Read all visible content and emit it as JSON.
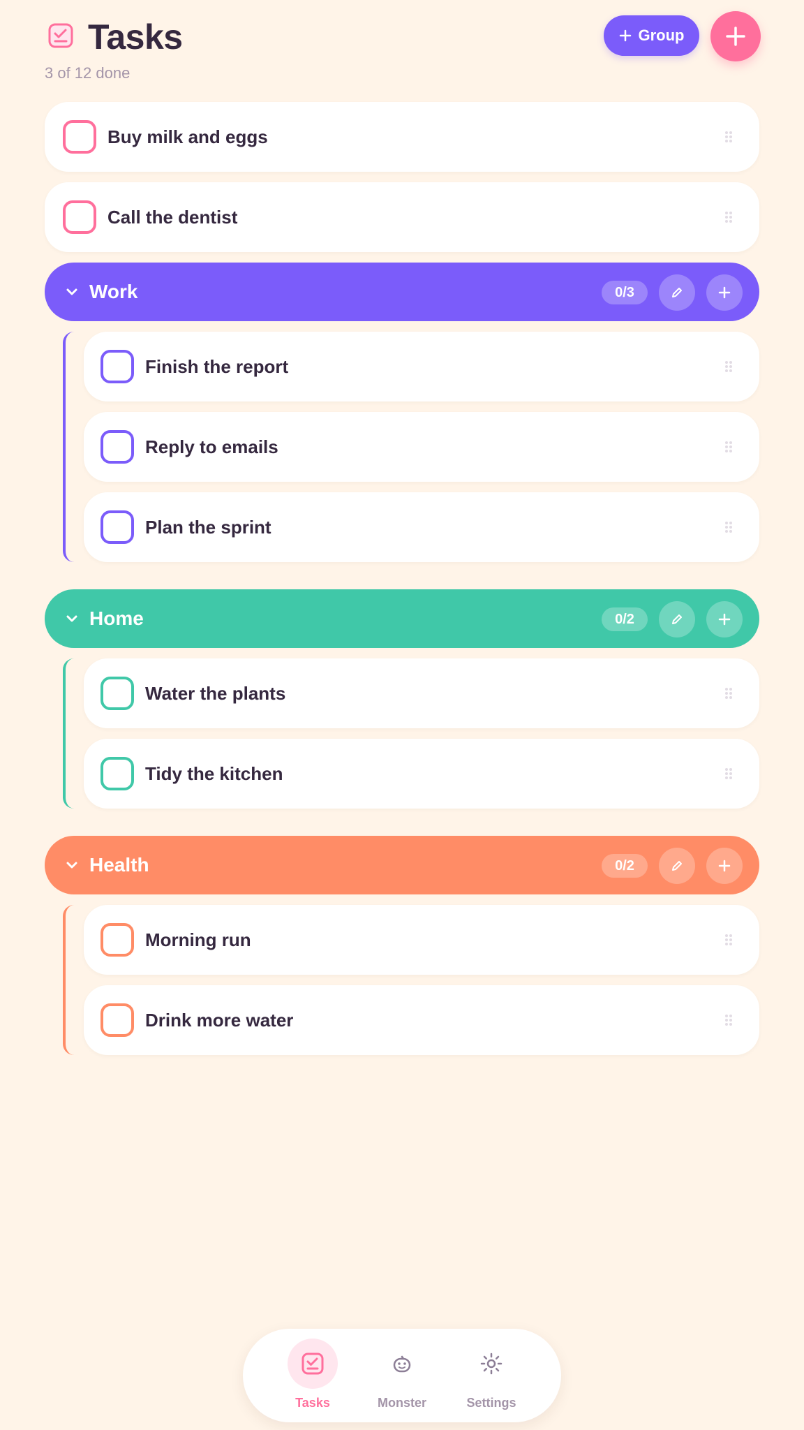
{
  "header": {
    "title": "Tasks",
    "subtitle": "3 of 12 done",
    "group_button_label": "Group",
    "app_icon": "checkbox-icon",
    "accent": "#FF6F9C"
  },
  "loose_tasks": [
    {
      "label": "Buy milk and eggs"
    },
    {
      "label": "Call the dentist"
    }
  ],
  "groups": [
    {
      "name": "Work",
      "count": "0/3",
      "color": "#7B5CFA",
      "tasks": [
        {
          "label": "Finish the report"
        },
        {
          "label": "Reply to emails"
        },
        {
          "label": "Plan the sprint"
        }
      ]
    },
    {
      "name": "Home",
      "count": "0/2",
      "color": "#40C8A8",
      "tasks": [
        {
          "label": "Water the plants"
        },
        {
          "label": "Tidy the kitchen"
        }
      ]
    },
    {
      "name": "Health",
      "count": "0/2",
      "color": "#FF8C66",
      "tasks": [
        {
          "label": "Morning run"
        },
        {
          "label": "Drink more water"
        }
      ]
    }
  ],
  "nav": [
    {
      "label": "Tasks",
      "icon": "tasks-icon",
      "active": true
    },
    {
      "label": "Monster",
      "icon": "monster-icon",
      "active": false
    },
    {
      "label": "Settings",
      "icon": "settings-icon",
      "active": false
    }
  ]
}
